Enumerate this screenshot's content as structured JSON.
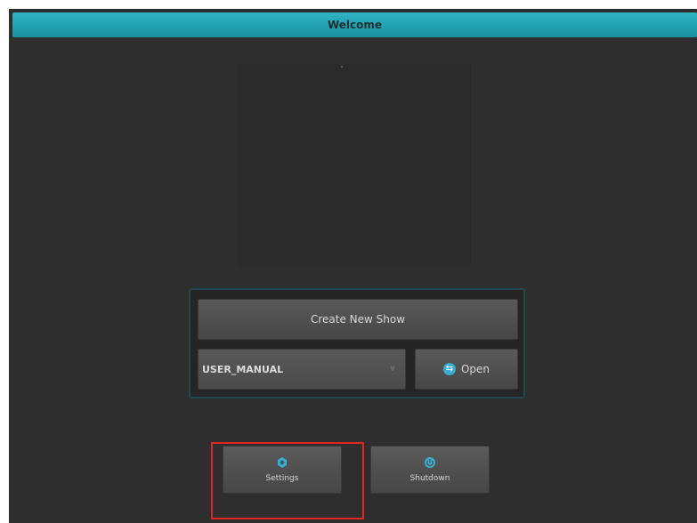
{
  "window": {
    "title": "Welcome"
  },
  "main_panel": {
    "create_button_label": "Create New Show",
    "show_select": {
      "selected_value": "USER_MANUAL"
    },
    "open_button_label": "Open"
  },
  "bottom_buttons": {
    "settings_label": "Settings",
    "shutdown_label": "Shutdown"
  },
  "icons": {
    "open": "open-circle-icon",
    "settings": "gear-icon",
    "shutdown": "power-icon",
    "dropdown": "chevron-down-icon"
  },
  "colors": {
    "title_bar": "#23a2b2",
    "background": "#2e2e2e",
    "button": "#525252",
    "accent_icon": "#3aaed0",
    "highlight": "#e32522"
  }
}
